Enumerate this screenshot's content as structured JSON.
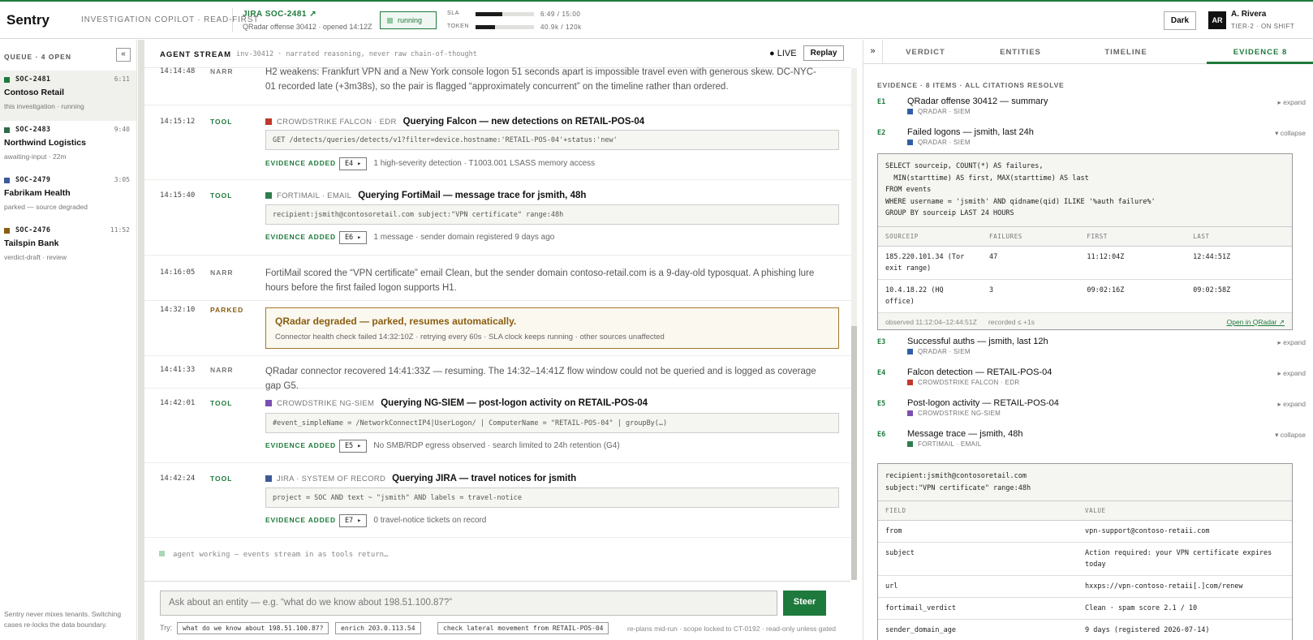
{
  "colors": {
    "accent": "#1e7a3c",
    "parked": "#8a5d10",
    "qradar": "#2f5ea8",
    "crowdstrike_falcon": "#c0392b",
    "fortimail": "#2e7d4f",
    "ngsiem": "#7b4fb0",
    "jira": "#3d5a99"
  },
  "topbar": {
    "brand": "Sentry",
    "mode": "INVESTIGATION COPILOT · READ-FIRST",
    "case_id": "JIRA SOC-2481 ↗",
    "case_sub": "QRadar offense 30412 · opened 14:12Z",
    "status": "running",
    "sla": {
      "label": "SLA",
      "value": "6:49 / 15:00",
      "fraction": 0.455
    },
    "token": {
      "label": "TOKEN",
      "value": "40.9k / 120k",
      "fraction": 0.34
    },
    "theme_button": "Dark",
    "avatar_initials": "AR",
    "user_name": "A. Rivera",
    "user_role": "TIER-2 · ON SHIFT"
  },
  "sidebar": {
    "heading": "QUEUE · 4 OPEN",
    "collapse_icon": "«",
    "items": [
      {
        "id": "SOC-2481",
        "time": "6:11",
        "name": "Contoso Retail",
        "state": "this investigation · running",
        "color": "#1e7a3c"
      },
      {
        "id": "SOC-2483",
        "time": "9:40",
        "name": "Northwind Logistics",
        "state": "awaiting-input · 22m",
        "color": "#2e6b45"
      },
      {
        "id": "SOC-2479",
        "time": "3:05",
        "name": "Fabrikam Health",
        "state": "parked — source degraded",
        "color": "#3d5a99"
      },
      {
        "id": "SOC-2476",
        "time": "11:52",
        "name": "Tailspin Bank",
        "state": "verdict-draft · review",
        "color": "#8a5d10"
      }
    ],
    "footer": "Sentry never mixes tenants. Switching cases re-locks the data boundary."
  },
  "stream": {
    "title": "AGENT STREAM",
    "subtitle": "inv-30412 · narrated reasoning, never raw chain-of-thought",
    "live": "● LIVE",
    "replay": "Replay",
    "events": [
      {
        "ts": "14:14:48",
        "kind": "NARR",
        "text": "H2 weakens: Frankfurt VPN and a New York console logon 51 seconds apart is impossible travel even with generous skew. DC-NYC-01 recorded late (+3m38s), so the pair is flagged “approximately concurrent” on the timeline rather than ordered."
      },
      {
        "ts": "14:15:12",
        "kind": "TOOL",
        "source": "CROWDSTRIKE FALCON · EDR",
        "title": "Querying Falcon — new detections on RETAIL-POS-04",
        "query": "GET /detects/queries/detects/v1?filter=device.hostname:'RETAIL-POS-04'+status:'new'",
        "added_label": "EVIDENCE ADDED",
        "chip": "E4 ▸",
        "result": "1 high-severity detection · T1003.001 LSASS memory access"
      },
      {
        "ts": "14:15:40",
        "kind": "TOOL",
        "source": "FORTIMAIL · EMAIL",
        "title": "Querying FortiMail — message trace for jsmith, 48h",
        "query": "recipient:jsmith@contosoretail.com subject:\"VPN certificate\" range:48h",
        "added_label": "EVIDENCE ADDED",
        "chip": "E6 ▸",
        "result": "1 message · sender domain registered 9 days ago"
      },
      {
        "ts": "14:16:05",
        "kind": "NARR",
        "text": "FortiMail scored the “VPN certificate” email Clean, but the sender domain contoso-retail.com is a 9-day-old typosquat. A phishing lure hours before the first failed logon supports H1."
      },
      {
        "ts": "14:32:10",
        "kind": "PARKED",
        "title": "QRadar degraded — parked, resumes automatically.",
        "text": "Connector health check failed 14:32:10Z · retrying every 60s · SLA clock keeps running · other sources unaffected"
      },
      {
        "ts": "14:41:33",
        "kind": "NARR",
        "text": "QRadar connector recovered 14:41:33Z — resuming. The 14:32–14:41Z flow window could not be queried and is logged as coverage gap G5."
      },
      {
        "ts": "14:42:01",
        "kind": "TOOL",
        "source": "CROWDSTRIKE NG-SIEM",
        "title": "Querying NG-SIEM — post-logon activity on RETAIL-POS-04",
        "query": "#event_simpleName = /NetworkConnectIP4|UserLogon/ | ComputerName = \"RETAIL-POS-04\" | groupBy(…)",
        "added_label": "EVIDENCE ADDED",
        "chip": "E5 ▸",
        "result": "No SMB/RDP egress observed · search limited to 24h retention (G4)"
      },
      {
        "ts": "14:42:24",
        "kind": "TOOL",
        "source": "JIRA · SYSTEM OF RECORD",
        "title": "Querying JIRA — travel notices for jsmith",
        "query": "project = SOC AND text ~ \"jsmith\" AND labels = travel-notice",
        "added_label": "EVIDENCE ADDED",
        "chip": "E7 ▸",
        "result": "0 travel-notice tickets on record"
      }
    ],
    "working": "agent working — events stream in as tools return…"
  },
  "composer": {
    "placeholder": "Ask about an entity — e.g. “what do we know about 198.51.100.87?”",
    "steer": "Steer",
    "try_label": "Try:",
    "suggestions": [
      "what do we know about 198.51.100.87?",
      "enrich 203.0.113.54",
      "check lateral movement from RETAIL-POS-04"
    ],
    "note": "re-plans mid-run · scope locked to CT-0192 · read-only unless gated"
  },
  "right_panel": {
    "expand_icon": "»",
    "tabs": [
      "VERDICT",
      "ENTITIES",
      "TIMELINE",
      "EVIDENCE 8"
    ],
    "heading": "EVIDENCE · 8 ITEMS · ALL CITATIONS RESOLVE",
    "items": [
      {
        "id": "E1",
        "title": "QRadar offense 30412 — summary",
        "source": "QRADAR · SIEM",
        "toggle": "▸ expand"
      },
      {
        "id": "E2",
        "title": "Failed logons — jsmith, last 24h",
        "source": "QRADAR · SIEM",
        "toggle": "▾ collapse"
      },
      {
        "id": "E3",
        "title": "Successful auths — jsmith, last 12h",
        "source": "QRADAR · SIEM",
        "toggle": "▸ expand"
      },
      {
        "id": "E4",
        "title": "Falcon detection — RETAIL-POS-04",
        "source": "CROWDSTRIKE FALCON · EDR",
        "toggle": "▸ expand"
      },
      {
        "id": "E5",
        "title": "Post-logon activity — RETAIL-POS-04",
        "source": "CROWDSTRIKE NG-SIEM",
        "toggle": "▸ expand"
      },
      {
        "id": "E6",
        "title": "Message trace — jsmith, 48h",
        "source": "FORTIMAIL · EMAIL",
        "toggle": "▾ collapse"
      }
    ],
    "e2": {
      "sql": "SELECT sourceip, COUNT(*) AS failures,\n  MIN(starttime) AS first, MAX(starttime) AS last\nFROM events\nWHERE username = 'jsmith' AND qidname(qid) ILIKE '%auth failure%'\nGROUP BY sourceip LAST 24 HOURS",
      "columns": [
        "SOURCEIP",
        "FAILURES",
        "FIRST",
        "LAST"
      ],
      "rows": [
        [
          "185.220.101.34 (Tor exit range)",
          "47",
          "11:12:04Z",
          "12:44:51Z"
        ],
        [
          "10.4.18.22 (HQ office)",
          "3",
          "09:02:16Z",
          "09:02:58Z"
        ]
      ],
      "observed": "observed 11:12:04–12:44:51Z      recorded ≤ +1s",
      "link": "Open in QRadar ↗"
    },
    "e6": {
      "query": "recipient:jsmith@contosoretail.com\nsubject:\"VPN certificate\" range:48h",
      "columns": [
        "FIELD",
        "VALUE"
      ],
      "rows": [
        [
          "from",
          "vpn-support@contoso-retaii.com"
        ],
        [
          "subject",
          "Action required: your VPN certificate expires today"
        ],
        [
          "url",
          "hxxps://vpn-contoso-retaii[.]com/renew"
        ],
        [
          "fortimail_verdict",
          "Clean · spam score 2.1 / 10"
        ],
        [
          "sender_domain_age",
          "9 days (registered 2026-07-14)"
        ]
      ]
    }
  }
}
